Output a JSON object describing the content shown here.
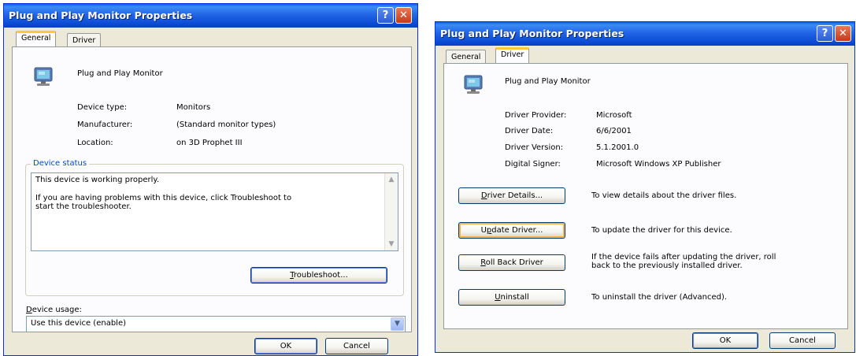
{
  "dialog_general": {
    "title": "Plug and Play Monitor Properties",
    "help_button": "?",
    "close_button": "✕",
    "tabs": [
      {
        "label": "General",
        "active": true
      },
      {
        "label": "Driver",
        "active": false
      }
    ],
    "device_name": "Plug and Play Monitor",
    "properties": [
      {
        "label": "Device type:",
        "value": "Monitors"
      },
      {
        "label": "Manufacturer:",
        "value": "(Standard monitor types)"
      },
      {
        "label": "Location:",
        "value": "on 3D Prophet III"
      }
    ],
    "device_status": {
      "label": "Device status",
      "line1": "This device is working properly.",
      "line2": "If you are having problems with this device, click Troubleshoot to",
      "line3": "start the troubleshooter."
    },
    "troubleshoot_button": {
      "pre": "",
      "accel": "T",
      "post": "roubleshoot..."
    },
    "device_usage": {
      "pre": "",
      "accel": "D",
      "post": "evice usage:"
    },
    "device_usage_value": "Use this device (enable)",
    "ok_button": "OK",
    "cancel_button": "Cancel"
  },
  "dialog_driver": {
    "title": "Plug and Play Monitor Properties",
    "help_button": "?",
    "close_button": "✕",
    "tabs": [
      {
        "label": "General",
        "active": false
      },
      {
        "label": "Driver",
        "active": true
      }
    ],
    "device_name": "Plug and Play Monitor",
    "properties": [
      {
        "label": "Driver Provider:",
        "value": "Microsoft"
      },
      {
        "label": "Driver Date:",
        "value": "6/6/2001"
      },
      {
        "label": "Driver Version:",
        "value": "5.1.2001.0"
      },
      {
        "label": "Digital Signer:",
        "value": "Microsoft Windows XP Publisher"
      }
    ],
    "actions": [
      {
        "pre": "",
        "accel": "D",
        "post": "river Details...",
        "desc1": "To view details about the driver files.",
        "desc2": ""
      },
      {
        "pre": "U",
        "accel": "p",
        "post": "date Driver...",
        "desc1": "To update the driver for this device.",
        "desc2": ""
      },
      {
        "pre": "",
        "accel": "R",
        "post": "oll Back Driver",
        "desc1": "If the device fails after updating the driver, roll",
        "desc2": "back to the previously installed driver."
      },
      {
        "pre": "",
        "accel": "U",
        "post": "ninstall",
        "desc1": "To uninstall the driver (Advanced).",
        "desc2": ""
      }
    ],
    "ok_button": "OK",
    "cancel_button": "Cancel"
  },
  "colors": {
    "titlebar": "#0A4BD4",
    "dialog_face": "#ECE9D8",
    "tab_highlight": "#FFC83C",
    "group_label": "#0046D5"
  }
}
